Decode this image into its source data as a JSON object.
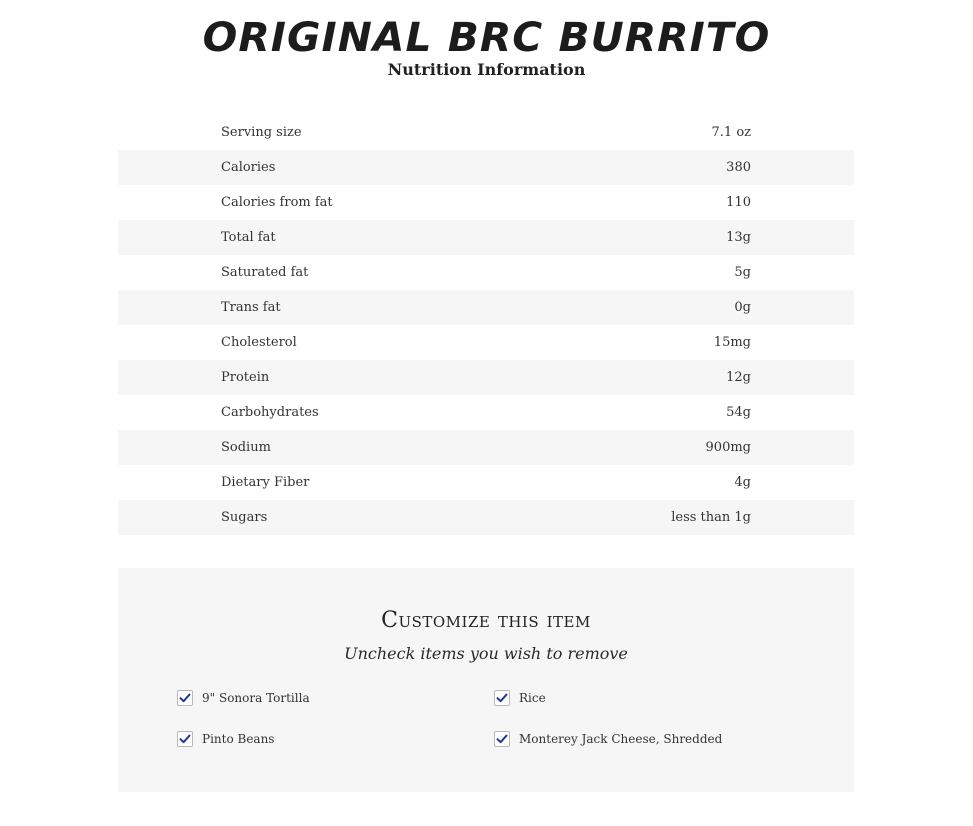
{
  "header": {
    "title": "ORIGINAL BRC BURRITO",
    "subtitle": "Nutrition Information"
  },
  "nutrition": {
    "rows": [
      {
        "label": "Serving size",
        "value": "7.1 oz"
      },
      {
        "label": "Calories",
        "value": "380"
      },
      {
        "label": "Calories from fat",
        "value": "110"
      },
      {
        "label": "Total fat",
        "value": "13g"
      },
      {
        "label": "Saturated fat",
        "value": "5g"
      },
      {
        "label": "Trans fat",
        "value": "0g"
      },
      {
        "label": "Cholesterol",
        "value": "15mg"
      },
      {
        "label": "Protein",
        "value": "12g"
      },
      {
        "label": "Carbohydrates",
        "value": "54g"
      },
      {
        "label": "Sodium",
        "value": "900mg"
      },
      {
        "label": "Dietary Fiber",
        "value": "4g"
      },
      {
        "label": "Sugars",
        "value": "less than 1g"
      }
    ]
  },
  "customize": {
    "title": "Customize this item",
    "subtitle": "Uncheck items you wish to remove",
    "options": [
      {
        "label": "9\" Sonora Tortilla",
        "checked": true
      },
      {
        "label": "Rice",
        "checked": true
      },
      {
        "label": "Pinto Beans",
        "checked": true
      },
      {
        "label": "Monterey Jack Cheese, Shredded",
        "checked": true
      }
    ]
  },
  "colors": {
    "check": "#1f3a93",
    "row_alt": "#f6f6f6",
    "panel": "#f6f6f6"
  }
}
